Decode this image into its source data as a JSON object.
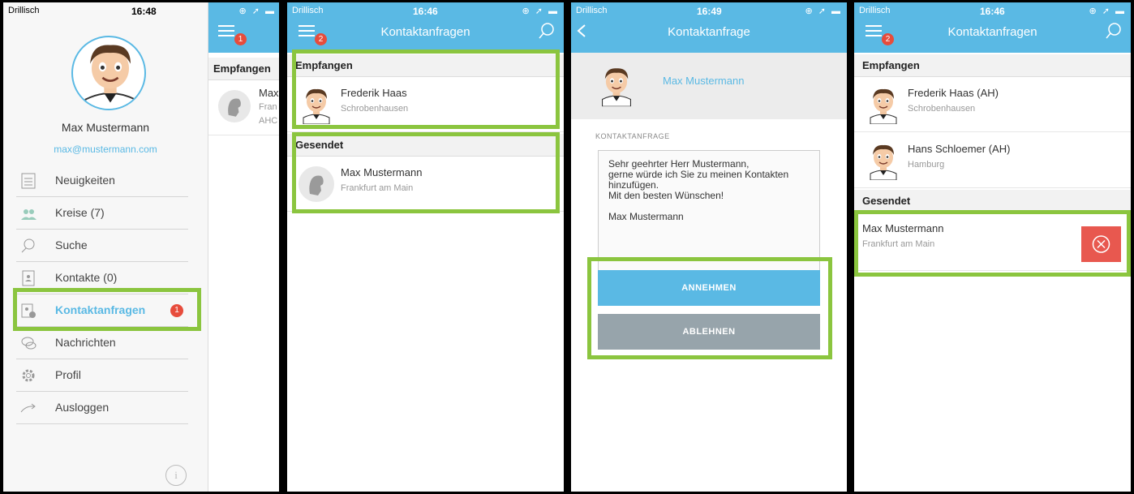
{
  "status_bars": [
    {
      "carrier": "Drillisch",
      "time": "16:48"
    },
    {
      "carrier": "Drillisch",
      "time": "16:46"
    },
    {
      "carrier": "Drillisch",
      "time": "16:49"
    },
    {
      "carrier": "Drillisch",
      "time": "16:46"
    }
  ],
  "drawer": {
    "user_name": "Max Mustermann",
    "user_email": "max@mustermann.com",
    "items": [
      {
        "label": "Neuigkeiten"
      },
      {
        "label": "Kreise (7)"
      },
      {
        "label": "Suche"
      },
      {
        "label": "Kontakte (0)"
      },
      {
        "label": "Kontaktanfragen",
        "badge": "1"
      },
      {
        "label": "Nachrichten"
      },
      {
        "label": "Profil"
      },
      {
        "label": "Ausloggen"
      }
    ],
    "info": "i",
    "peek": {
      "menu_badge": "1",
      "section": "Empfangen",
      "row_name": "Max",
      "row_city": "Fran",
      "row_extra": "AHC"
    }
  },
  "list_screen": {
    "title": "Kontaktanfragen",
    "menu_badge": "2",
    "received_header": "Empfangen",
    "received": [
      {
        "name": "Frederik Haas",
        "city": "Schrobenhausen"
      }
    ],
    "sent_header": "Gesendet",
    "sent": [
      {
        "name": "Max Mustermann",
        "city": "Frankfurt am Main"
      }
    ]
  },
  "detail_screen": {
    "title": "Kontaktanfrage",
    "name": "Max Mustermann",
    "label": "KONTAKTANFRAGE",
    "message": "Sehr geehrter Herr Mustermann,\ngerne würde ich Sie zu meinen Kontakten hinzufügen.\nMit den besten Wünschen!\n\nMax Mustermann",
    "accept": "ANNEHMEN",
    "reject": "ABLEHNEN",
    "colors": {
      "accept": "#5ab9e4",
      "reject": "#97a4ab"
    }
  },
  "list_screen_2": {
    "title": "Kontaktanfragen",
    "menu_badge": "2",
    "received_header": "Empfangen",
    "received": [
      {
        "name": "Frederik Haas (AH)",
        "city": "Schrobenhausen"
      },
      {
        "name": "Hans Schloemer (AH)",
        "city": "Hamburg"
      }
    ],
    "sent_header": "Gesendet",
    "sent": [
      {
        "name": "Max Mustermann",
        "city": "Frankfurt am Main"
      }
    ]
  },
  "colors": {
    "header": "#5ab9e4",
    "highlight": "#8bc53f",
    "badge": "#e74c3c",
    "delete": "#e8584f"
  }
}
